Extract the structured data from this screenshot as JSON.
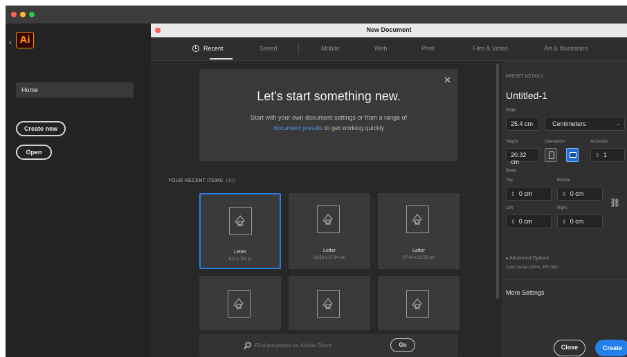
{
  "colors": {
    "accent": "#2680eb",
    "traffic_red": "#ff5f57",
    "traffic_yellow": "#febc2e",
    "traffic_green": "#28c840",
    "ai_orange": "#ff9a00"
  },
  "app": {
    "logo_text": "Ai",
    "back_icon": "chevron-left-icon"
  },
  "sidebar": {
    "home_label": "Home",
    "create_new_label": "Create new",
    "open_label": "Open"
  },
  "dialog": {
    "title": "New Document",
    "tabs": [
      {
        "label": "Recent",
        "icon": "clock-icon",
        "active": true
      },
      {
        "label": "Saved"
      },
      {
        "label": "Mobile"
      },
      {
        "label": "Web"
      },
      {
        "label": "Print"
      },
      {
        "label": "Film & Video"
      },
      {
        "label": "Art & Illustration"
      }
    ],
    "welcome": {
      "title": "Let's start something new.",
      "body_before": "Start with your own document settings or from a range of ",
      "body_link": "document presets",
      "body_after": " to get working quickly",
      "close_symbol": "✕"
    },
    "recent": {
      "label": "YOUR RECENT ITEMS",
      "count": "(30)",
      "items": [
        {
          "name": "Letter",
          "dims": "612 x 792 pt",
          "selected": true
        },
        {
          "name": "Letter",
          "dims": "21.59 x 27.94 cm"
        },
        {
          "name": "Letter",
          "dims": "27.94 x 21.59 cm"
        },
        {
          "name": "",
          "dims": ""
        },
        {
          "name": "",
          "dims": ""
        },
        {
          "name": "",
          "dims": ""
        }
      ]
    },
    "search": {
      "placeholder": "Find templates on Adobe Stock",
      "go_label": "Go"
    }
  },
  "preset": {
    "header": "PRESET DETAILS",
    "name": "Untitled-1",
    "width_label": "Width",
    "width_value": "25.4 cm",
    "units": "Centimeters",
    "height_label": "Height",
    "height_value": "20.32 cm",
    "orientation_label": "Orientation",
    "artboards_label": "Artboards",
    "artboards_value": "1",
    "bleed_label": "Bleed",
    "top_label": "Top",
    "top_value": "0 cm",
    "bottom_label": "Bottom",
    "bottom_value": "0 cm",
    "left_label": "Left",
    "left_value": "0 cm",
    "right_label": "Right",
    "right_value": "0 cm",
    "advanced_label": "Advanced Options",
    "color_mode": "Color Mode:CMYK, PPI:300",
    "more_settings": "More Settings",
    "close_label": "Close",
    "create_label": "Create"
  }
}
